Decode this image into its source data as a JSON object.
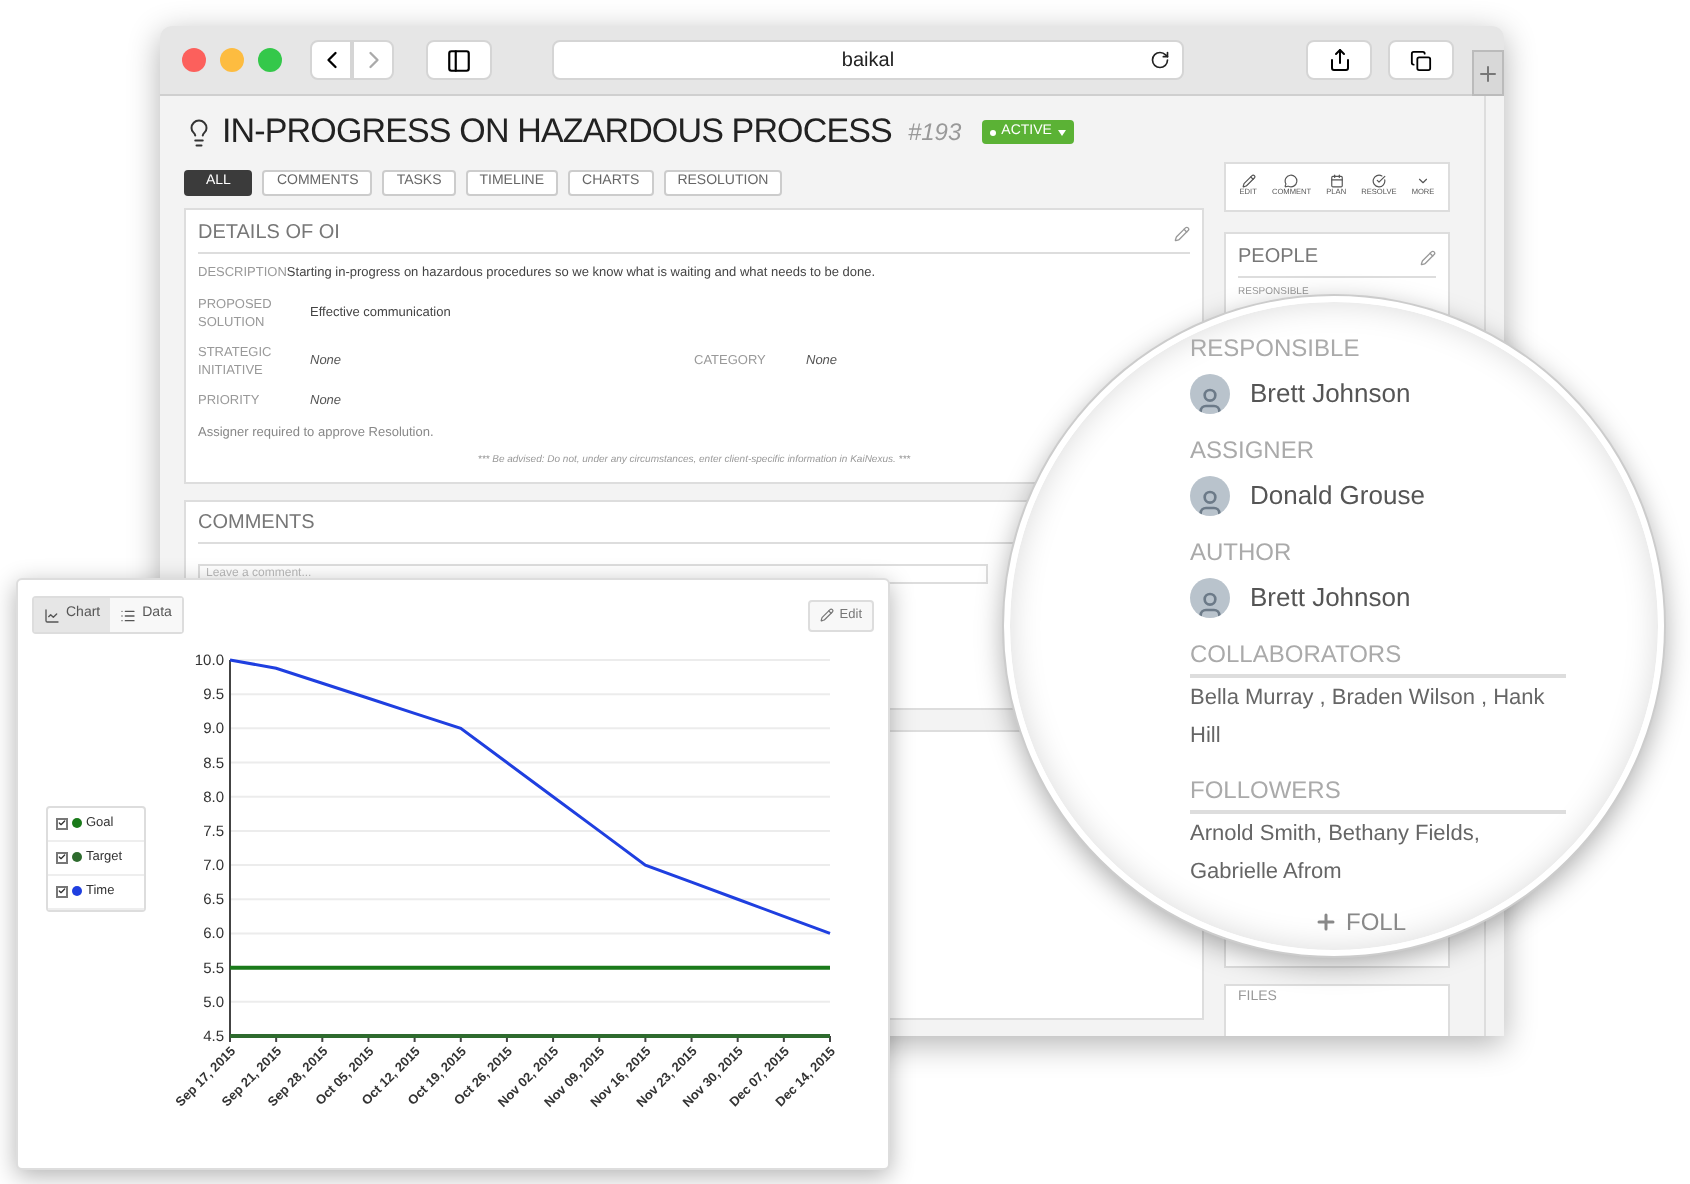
{
  "browser": {
    "address": "baikal"
  },
  "header": {
    "title": "IN-PROGRESS ON HAZARDOUS PROCESS",
    "number": "#193",
    "status": "ACTIVE"
  },
  "tabs": [
    {
      "label": "ALL",
      "selected": true
    },
    {
      "label": "COMMENTS",
      "selected": false
    },
    {
      "label": "TASKS",
      "selected": false
    },
    {
      "label": "TIMELINE",
      "selected": false
    },
    {
      "label": "CHARTS",
      "selected": false
    },
    {
      "label": "RESOLUTION",
      "selected": false
    }
  ],
  "actions": [
    {
      "label": "EDIT",
      "kind": "edit"
    },
    {
      "label": "COMMENT",
      "kind": "comment"
    },
    {
      "label": "PLAN",
      "kind": "plan"
    },
    {
      "label": "RESOLVE",
      "kind": "resolve"
    },
    {
      "label": "MORE",
      "kind": "more"
    }
  ],
  "details": {
    "title": "DETAILS OF OI",
    "rows": [
      {
        "cells": [
          {
            "label": "DESCRIPTION",
            "value": "Starting in-progress on hazardous procedures so we know what is waiting and what needs to be done.",
            "is_none": false
          }
        ]
      },
      {
        "cells": [
          {
            "label": "PROPOSED SOLUTION",
            "value": "Effective communication",
            "is_none": false
          }
        ]
      },
      {
        "cells": [
          {
            "label": "STRATEGIC INITIATIVE",
            "value": "None",
            "is_none": true
          },
          {
            "label": "CATEGORY",
            "value": "None",
            "is_none": true
          }
        ]
      },
      {
        "cells": [
          {
            "label": "PRIORITY",
            "value": "None",
            "is_none": true
          }
        ]
      }
    ],
    "note": "Assigner required to approve Resolution.",
    "disclaimer": "*** Be advised: Do not, under any circumstances, enter client-specific information in KaiNexus. ***"
  },
  "comments": {
    "title": "COMMENTS",
    "placeholder": "Leave a comment..."
  },
  "people": {
    "title": "PEOPLE",
    "first_label": "RESPONSIBLE"
  },
  "files": {
    "title": "FILES"
  },
  "magnifier": {
    "roles": [
      {
        "label": "RESPONSIBLE",
        "name": "Brett Johnson"
      },
      {
        "label": "ASSIGNER",
        "name": "Donald Grouse"
      },
      {
        "label": "AUTHOR",
        "name": "Brett Johnson"
      }
    ],
    "groups": [
      {
        "label": "COLLABORATORS",
        "names": "Bella Murray , Braden Wilson , Hank Hill"
      },
      {
        "label": "FOLLOWERS",
        "names": "Arnold Smith, Bethany Fields, Gabrielle Afrom"
      }
    ],
    "follow_button": "FOLL"
  },
  "chart_panel": {
    "views": [
      {
        "label": "Chart",
        "selected": true
      },
      {
        "label": "Data",
        "selected": false
      }
    ],
    "edit_button": "Edit",
    "legend": [
      {
        "checked": true
      },
      {
        "checked": true
      },
      {
        "checked": true
      }
    ],
    "chart_data": {
      "type": "line",
      "categories": [
        "Sep 17, 2015",
        "Sep 21, 2015",
        "Sep 28, 2015",
        "Oct 05, 2015",
        "Oct 12, 2015",
        "Oct 19, 2015",
        "Oct 26, 2015",
        "Nov 02, 2015",
        "Nov 09, 2015",
        "Nov 16, 2015",
        "Nov 23, 2015",
        "Nov 30, 2015",
        "Dec 07, 2015",
        "Dec 14, 2015"
      ],
      "series": [
        {
          "name": "Goal",
          "color": "#1a7a1a",
          "values": [
            5.5,
            5.5,
            5.5,
            5.5,
            5.5,
            5.5,
            5.5,
            5.5,
            5.5,
            5.5,
            5.5,
            5.5,
            5.5,
            5.5
          ]
        },
        {
          "name": "Target",
          "color": "#2e6b2e",
          "values": [
            4.5,
            4.5,
            4.5,
            4.5,
            4.5,
            4.5,
            4.5,
            4.5,
            4.5,
            4.5,
            4.5,
            4.5,
            4.5,
            4.5
          ]
        },
        {
          "name": "Time",
          "color": "#1f3fe0",
          "values": [
            10,
            9.88,
            9.66,
            9.44,
            9.22,
            9.0,
            8.5,
            8.0,
            7.5,
            7.0,
            6.75,
            6.5,
            6.25,
            6.0
          ]
        }
      ],
      "ylim": [
        4.5,
        10
      ],
      "grid": true,
      "yticks": [
        {
          "value": 4.5,
          "label": "4.5"
        },
        {
          "value": 5,
          "label": "5.0"
        },
        {
          "value": 5.5,
          "label": "5.5"
        },
        {
          "value": 6,
          "label": "6.0"
        },
        {
          "value": 6.5,
          "label": "6.5"
        },
        {
          "value": 7,
          "label": "7.0"
        },
        {
          "value": 7.5,
          "label": "7.5"
        },
        {
          "value": 8,
          "label": "8.0"
        },
        {
          "value": 8.5,
          "label": "8.5"
        },
        {
          "value": 9,
          "label": "9.0"
        },
        {
          "value": 9.5,
          "label": "9.5"
        },
        {
          "value": 10,
          "label": "10.0"
        }
      ]
    }
  }
}
